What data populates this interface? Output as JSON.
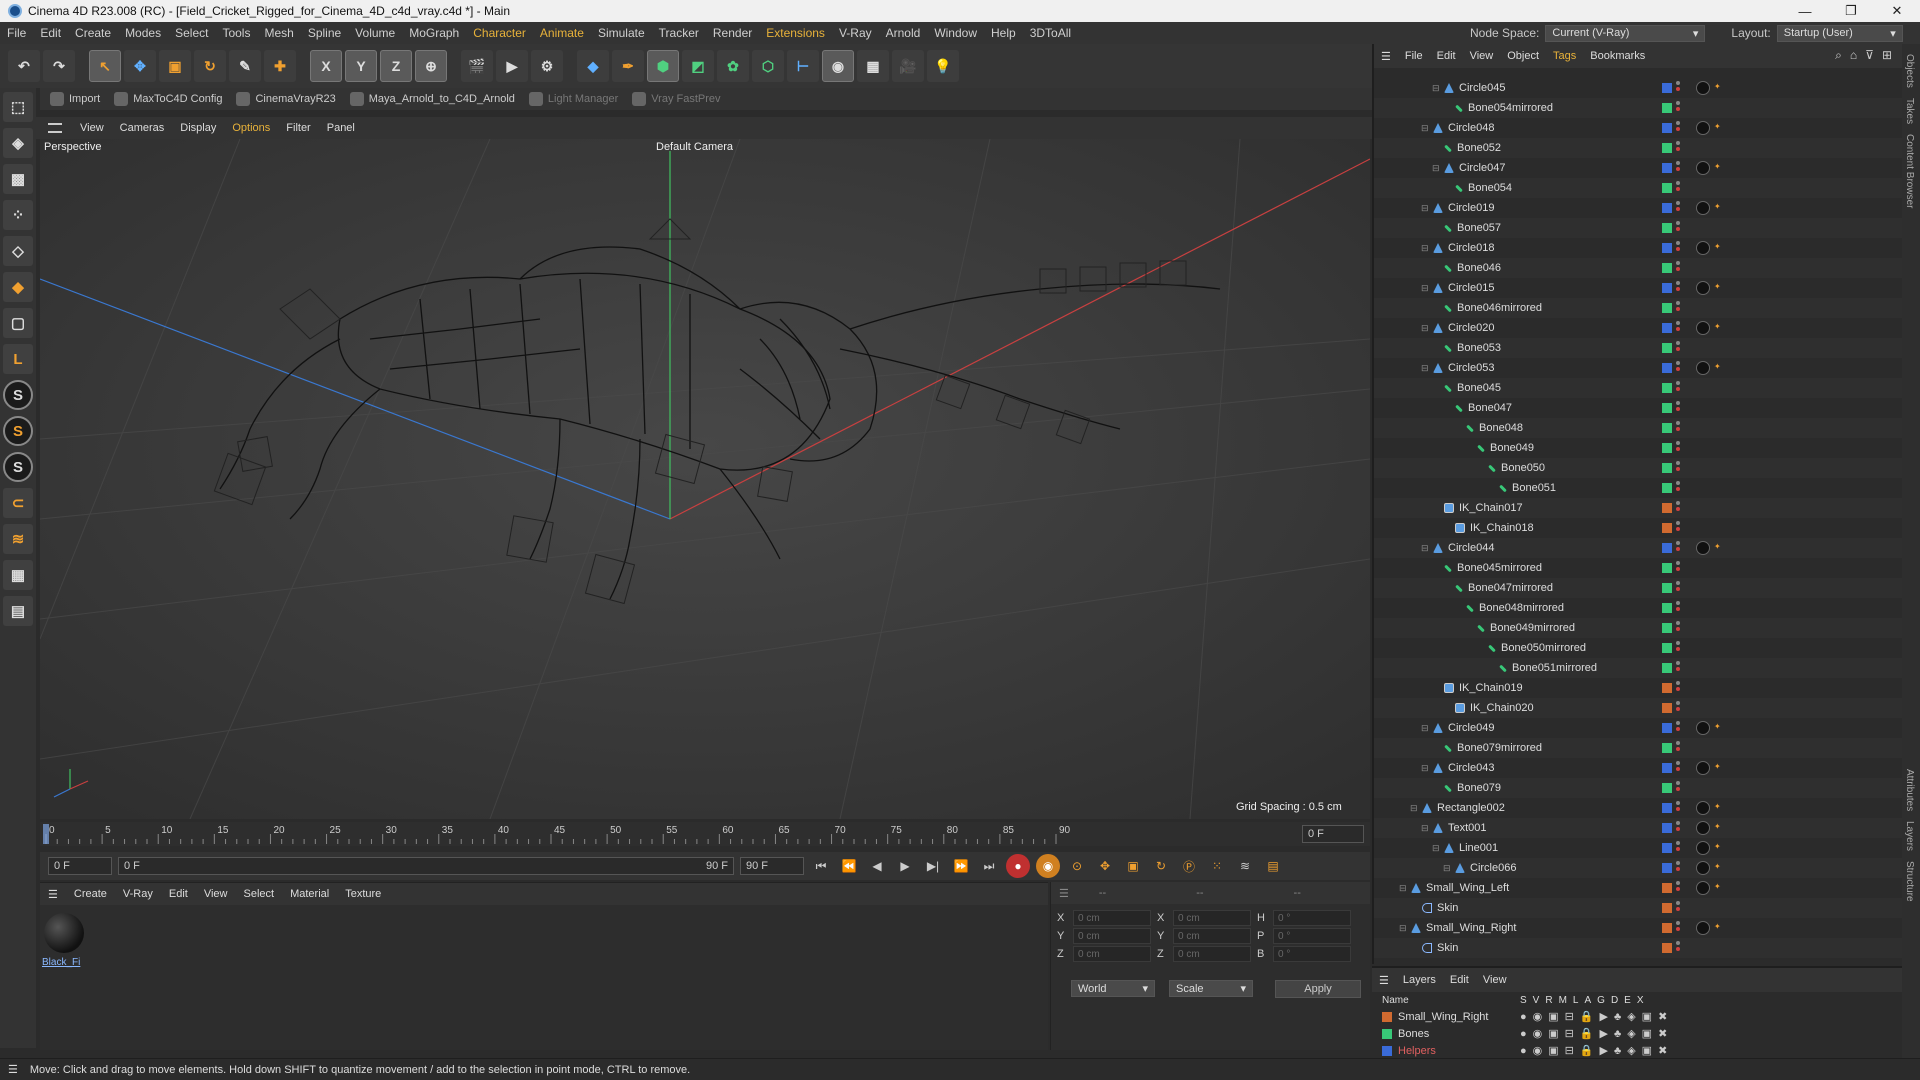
{
  "title": "Cinema 4D R23.008 (RC) - [Field_Cricket_Rigged_for_Cinema_4D_c4d_vray.c4d *] - Main",
  "menu": [
    "File",
    "Edit",
    "Create",
    "Modes",
    "Select",
    "Tools",
    "Mesh",
    "Spline",
    "Volume",
    "MoGraph",
    "Character",
    "Animate",
    "Simulate",
    "Tracker",
    "Render",
    "Extensions",
    "V-Ray",
    "Arnold",
    "Window",
    "Help",
    "3DToAll"
  ],
  "node_space": {
    "label": "Node Space:",
    "value": "Current (V-Ray)"
  },
  "layout": {
    "label": "Layout:",
    "value": "Startup (User)"
  },
  "plugins": [
    {
      "label": "Import",
      "enabled": true
    },
    {
      "label": "MaxToC4D Config",
      "enabled": true
    },
    {
      "label": "CinemaVrayR23",
      "enabled": true
    },
    {
      "label": "Maya_Arnold_to_C4D_Arnold",
      "enabled": true
    },
    {
      "label": "Light Manager",
      "enabled": false
    },
    {
      "label": "Vray FastPrev",
      "enabled": false
    }
  ],
  "viewport_menu": [
    "View",
    "Cameras",
    "Display",
    "Options",
    "Filter",
    "Panel"
  ],
  "viewport": {
    "name": "Perspective",
    "camera": "Default Camera",
    "grid_spacing": "Grid Spacing : 0.5 cm"
  },
  "timeline": {
    "ticks": [
      "0",
      "5",
      "10",
      "15",
      "20",
      "25",
      "30",
      "35",
      "40",
      "45",
      "50",
      "55",
      "60",
      "65",
      "70",
      "75",
      "80",
      "85",
      "90"
    ],
    "end_field": "0 F"
  },
  "transport": {
    "start": "0 F",
    "current": "0 F",
    "end": "90 F",
    "end2": "90 F"
  },
  "material_menu": [
    "Create",
    "V-Ray",
    "Edit",
    "View",
    "Select",
    "Material",
    "Texture"
  ],
  "material": {
    "name": "Black_Fi"
  },
  "attributes": {
    "header": "--",
    "rows": [
      {
        "a": "X",
        "av": "0 cm",
        "b": "X",
        "bv": "0 cm",
        "c": "H",
        "cv": "0 °"
      },
      {
        "a": "Y",
        "av": "0 cm",
        "b": "Y",
        "bv": "0 cm",
        "c": "P",
        "cv": "0 °"
      },
      {
        "a": "Z",
        "av": "0 cm",
        "b": "Z",
        "bv": "0 cm",
        "c": "B",
        "cv": "0 °"
      }
    ],
    "coord": "World",
    "mode": "Scale",
    "apply": "Apply"
  },
  "status": "Move: Click and drag to move elements. Hold down SHIFT to quantize movement / add to the selection in point mode, CTRL to remove.",
  "object_menu": [
    "File",
    "Edit",
    "View",
    "Object",
    "Tags",
    "Bookmarks"
  ],
  "objects": [
    {
      "name": "Circle045",
      "indent": 4,
      "icon": "null",
      "color": "#3a6bd8",
      "tags": true
    },
    {
      "name": "Bone054mirrored",
      "indent": 5,
      "icon": "bone",
      "color": "#38c878",
      "tags": false
    },
    {
      "name": "Circle048",
      "indent": 3,
      "icon": "null",
      "color": "#3a6bd8",
      "tags": true
    },
    {
      "name": "Bone052",
      "indent": 4,
      "icon": "bone",
      "color": "#38c878",
      "tags": false
    },
    {
      "name": "Circle047",
      "indent": 4,
      "icon": "null",
      "color": "#3a6bd8",
      "tags": true
    },
    {
      "name": "Bone054",
      "indent": 5,
      "icon": "bone",
      "color": "#38c878",
      "tags": false
    },
    {
      "name": "Circle019",
      "indent": 3,
      "icon": "null",
      "color": "#3a6bd8",
      "tags": true
    },
    {
      "name": "Bone057",
      "indent": 4,
      "icon": "bone",
      "color": "#38c878",
      "tags": false
    },
    {
      "name": "Circle018",
      "indent": 3,
      "icon": "null",
      "color": "#3a6bd8",
      "tags": true
    },
    {
      "name": "Bone046",
      "indent": 4,
      "icon": "bone",
      "color": "#38c878",
      "tags": false
    },
    {
      "name": "Circle015",
      "indent": 3,
      "icon": "null",
      "color": "#3a6bd8",
      "tags": true
    },
    {
      "name": "Bone046mirrored",
      "indent": 4,
      "icon": "bone",
      "color": "#38c878",
      "tags": false
    },
    {
      "name": "Circle020",
      "indent": 3,
      "icon": "null",
      "color": "#3a6bd8",
      "tags": true
    },
    {
      "name": "Bone053",
      "indent": 4,
      "icon": "bone",
      "color": "#38c878",
      "tags": false
    },
    {
      "name": "Circle053",
      "indent": 3,
      "icon": "null",
      "color": "#3a6bd8",
      "tags": true
    },
    {
      "name": "Bone045",
      "indent": 4,
      "icon": "bone",
      "color": "#38c878",
      "tags": false
    },
    {
      "name": "Bone047",
      "indent": 5,
      "icon": "bone",
      "color": "#38c878",
      "tags": false
    },
    {
      "name": "Bone048",
      "indent": 6,
      "icon": "bone",
      "color": "#38c878",
      "tags": false
    },
    {
      "name": "Bone049",
      "indent": 7,
      "icon": "bone",
      "color": "#38c878",
      "tags": false
    },
    {
      "name": "Bone050",
      "indent": 8,
      "icon": "bone",
      "color": "#38c878",
      "tags": false
    },
    {
      "name": "Bone051",
      "indent": 9,
      "icon": "bone",
      "color": "#38c878",
      "tags": false
    },
    {
      "name": "IK_Chain017",
      "indent": 4,
      "icon": "ik",
      "color": "#d06a30",
      "tags": false
    },
    {
      "name": "IK_Chain018",
      "indent": 5,
      "icon": "ik",
      "color": "#d06a30",
      "tags": false
    },
    {
      "name": "Circle044",
      "indent": 3,
      "icon": "null",
      "color": "#3a6bd8",
      "tags": true
    },
    {
      "name": "Bone045mirrored",
      "indent": 4,
      "icon": "bone",
      "color": "#38c878",
      "tags": false
    },
    {
      "name": "Bone047mirrored",
      "indent": 5,
      "icon": "bone",
      "color": "#38c878",
      "tags": false
    },
    {
      "name": "Bone048mirrored",
      "indent": 6,
      "icon": "bone",
      "color": "#38c878",
      "tags": false
    },
    {
      "name": "Bone049mirrored",
      "indent": 7,
      "icon": "bone",
      "color": "#38c878",
      "tags": false
    },
    {
      "name": "Bone050mirrored",
      "indent": 8,
      "icon": "bone",
      "color": "#38c878",
      "tags": false
    },
    {
      "name": "Bone051mirrored",
      "indent": 9,
      "icon": "bone",
      "color": "#38c878",
      "tags": false
    },
    {
      "name": "IK_Chain019",
      "indent": 4,
      "icon": "ik",
      "color": "#d06a30",
      "tags": false
    },
    {
      "name": "IK_Chain020",
      "indent": 5,
      "icon": "ik",
      "color": "#d06a30",
      "tags": false
    },
    {
      "name": "Circle049",
      "indent": 3,
      "icon": "null",
      "color": "#3a6bd8",
      "tags": true
    },
    {
      "name": "Bone079mirrored",
      "indent": 4,
      "icon": "bone",
      "color": "#38c878",
      "tags": false
    },
    {
      "name": "Circle043",
      "indent": 3,
      "icon": "null",
      "color": "#3a6bd8",
      "tags": true
    },
    {
      "name": "Bone079",
      "indent": 4,
      "icon": "bone",
      "color": "#38c878",
      "tags": false
    },
    {
      "name": "Rectangle002",
      "indent": 2,
      "icon": "null",
      "color": "#3a6bd8",
      "tags": true
    },
    {
      "name": "Text001",
      "indent": 3,
      "icon": "null",
      "color": "#3a6bd8",
      "tags": true
    },
    {
      "name": "Line001",
      "indent": 4,
      "icon": "null",
      "color": "#3a6bd8",
      "tags": true
    },
    {
      "name": "Circle066",
      "indent": 5,
      "icon": "null",
      "color": "#3a6bd8",
      "tags": true
    },
    {
      "name": "Small_Wing_Left",
      "indent": 1,
      "icon": "null",
      "color": "#d06a30",
      "tags": true
    },
    {
      "name": "Skin",
      "indent": 2,
      "icon": "skin",
      "color": "#d06a30",
      "tags": false
    },
    {
      "name": "Small_Wing_Right",
      "indent": 1,
      "icon": "null",
      "color": "#d06a30",
      "tags": true
    },
    {
      "name": "Skin",
      "indent": 2,
      "icon": "skin",
      "color": "#d06a30",
      "tags": false
    }
  ],
  "layers_menu": [
    "Layers",
    "Edit",
    "View"
  ],
  "layers_header": {
    "name": "Name",
    "cols": [
      "S",
      "V",
      "R",
      "M",
      "L",
      "A",
      "G",
      "D",
      "E",
      "X"
    ]
  },
  "layers": [
    {
      "name": "Small_Wing_Right",
      "color": "#d06a30"
    },
    {
      "name": "Bones",
      "color": "#38c878"
    },
    {
      "name": "Helpers",
      "color": "#3a6bd8"
    }
  ],
  "side_tabs": [
    "Objects",
    "Takes",
    "Content Browser",
    "Attributes",
    "Layers",
    "Structure"
  ]
}
